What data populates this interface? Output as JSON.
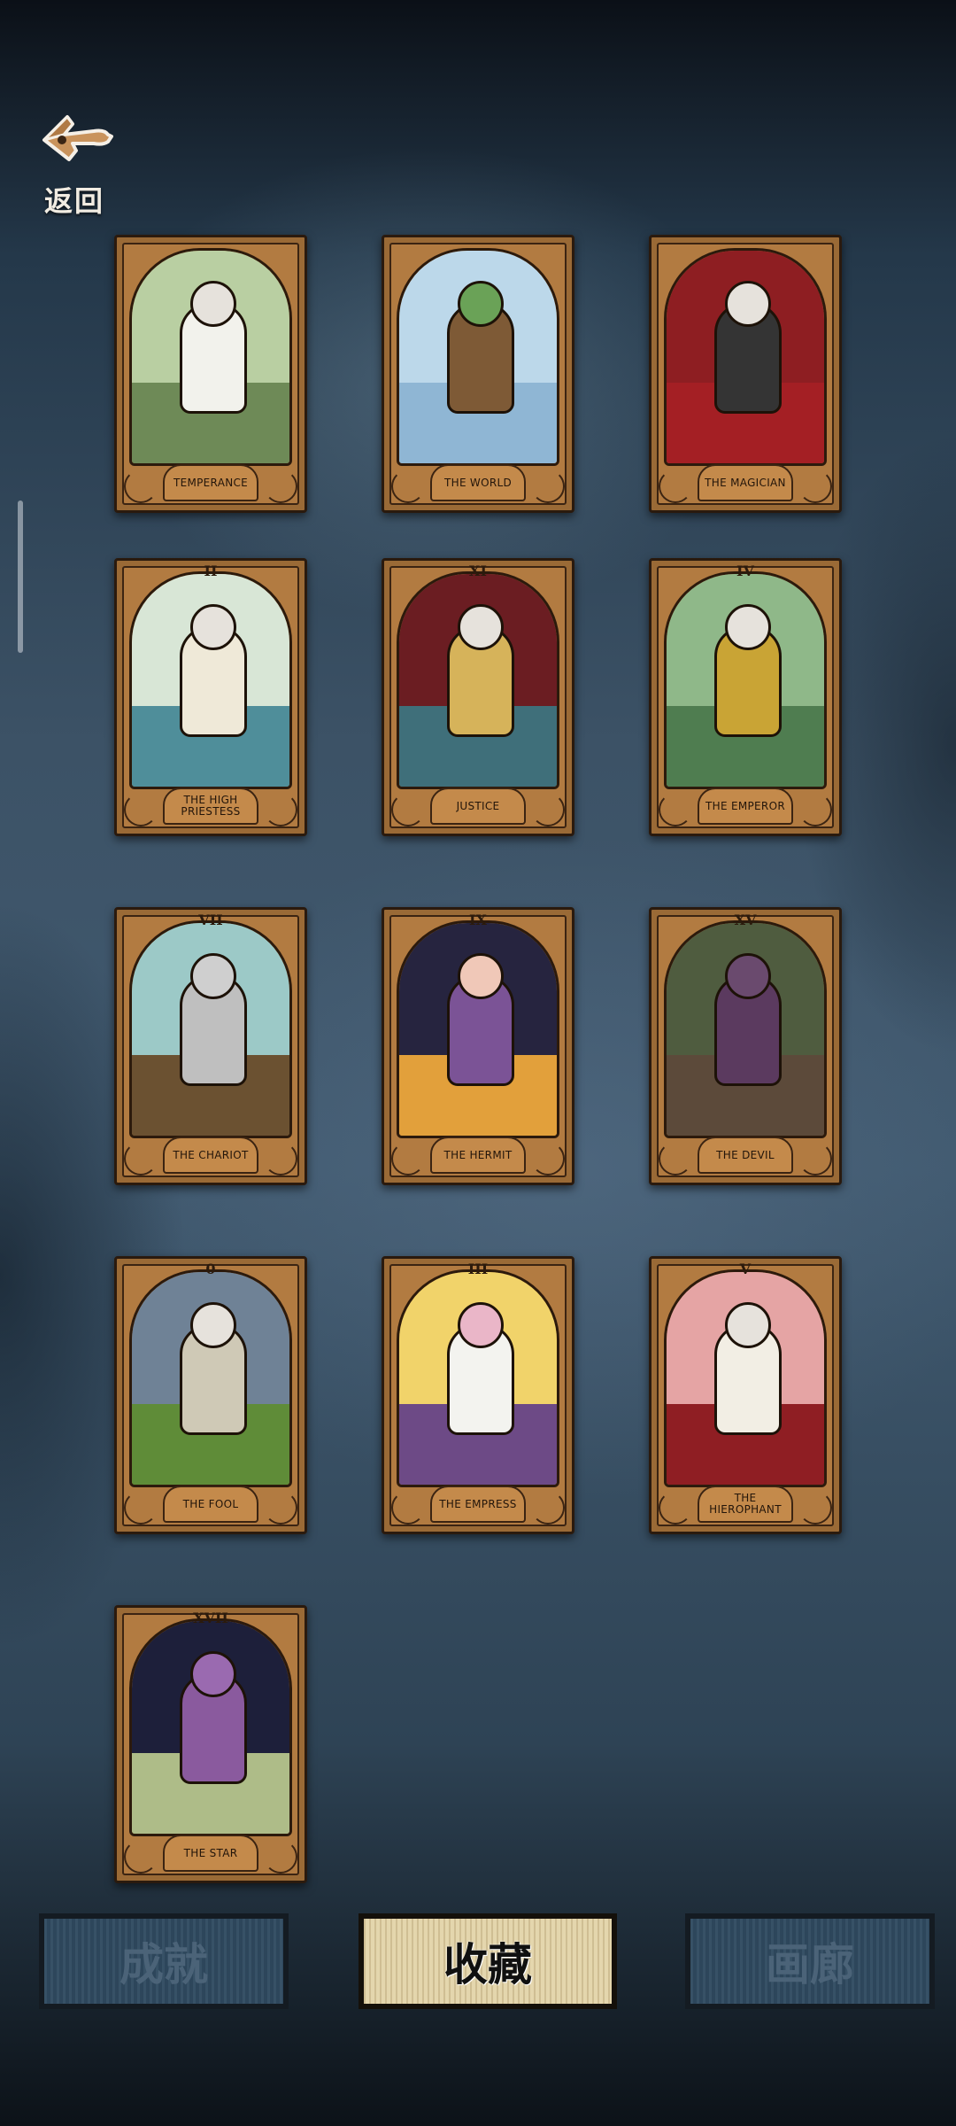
{
  "header": {
    "back_label": "返回"
  },
  "cards": [
    {
      "name": "Temperance",
      "numeral": "",
      "sky": "#b9cfa2",
      "ground": "#6e8a57",
      "robe": "#f2f2ec"
    },
    {
      "name": "The World",
      "numeral": "",
      "sky": "#bcd8ea",
      "ground": "#8fb6d4",
      "robe": "#7e5a36"
    },
    {
      "name": "The Magician",
      "numeral": "",
      "sky": "#8e1e22",
      "ground": "#a41f24",
      "robe": "#343434"
    },
    {
      "name": "The High Priestess",
      "numeral": "II",
      "sky": "#d8e6d6",
      "ground": "#4f8e9a",
      "robe": "#efe9d8"
    },
    {
      "name": "Justice",
      "numeral": "XI",
      "sky": "#6b1d22",
      "ground": "#3f6f7a",
      "robe": "#d6b35a"
    },
    {
      "name": "The Emperor",
      "numeral": "IV",
      "sky": "#8fb889",
      "ground": "#4f7d50",
      "robe": "#c9a435"
    },
    {
      "name": "The Chariot",
      "numeral": "VII",
      "sky": "#9cc9c7",
      "ground": "#6b5131",
      "robe": "#bfbfbf"
    },
    {
      "name": "The Hermit",
      "numeral": "IX",
      "sky": "#26243f",
      "ground": "#e2a03b",
      "robe": "#7b5396"
    },
    {
      "name": "The Devil",
      "numeral": "XV",
      "sky": "#4f5c3f",
      "ground": "#5c4a3a",
      "robe": "#5b3a5f"
    },
    {
      "name": "The Fool",
      "numeral": "0",
      "sky": "#6f8296",
      "ground": "#5f8c38",
      "robe": "#cfc9b6"
    },
    {
      "name": "The Empress",
      "numeral": "III",
      "sky": "#f1d36a",
      "ground": "#6d4a86",
      "robe": "#f3f3ef"
    },
    {
      "name": "The Hierophant",
      "numeral": "V",
      "sky": "#e5a4a4",
      "ground": "#8f1e23",
      "robe": "#f2eee4"
    },
    {
      "name": "The Star",
      "numeral": "XVII",
      "sky": "#1d1f3a",
      "ground": "#aebc88",
      "robe": "#8a5a9e"
    }
  ],
  "tabs": [
    {
      "label": "成就",
      "active": false
    },
    {
      "label": "收藏",
      "active": true
    },
    {
      "label": "画廊",
      "active": false
    }
  ]
}
